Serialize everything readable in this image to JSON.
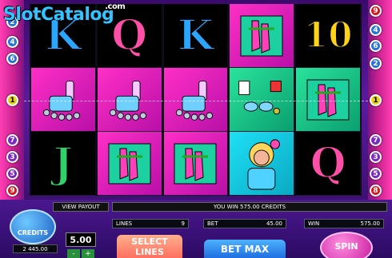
{
  "branding": {
    "name": "SlotCatalog",
    "suffix": ".com"
  },
  "paylines_left": [
    "2",
    "4",
    "6",
    "1",
    "7",
    "3",
    "5",
    "9"
  ],
  "paylines_right": [
    "9",
    "4",
    "6",
    "2",
    "1",
    "7",
    "3",
    "5",
    "8"
  ],
  "reels": [
    [
      {
        "type": "letter",
        "value": "K",
        "cls": "k"
      },
      {
        "type": "icon",
        "value": "spray-jewelry-icon",
        "bg": "pink"
      },
      {
        "type": "letter",
        "value": "J",
        "cls": "j"
      }
    ],
    [
      {
        "type": "letter",
        "value": "Q",
        "cls": "q"
      },
      {
        "type": "icon",
        "value": "spray-jewelry-icon",
        "bg": "pink"
      },
      {
        "type": "icon",
        "value": "leg-warmers-icon",
        "bg": "pink"
      }
    ],
    [
      {
        "type": "letter",
        "value": "K",
        "cls": "k"
      },
      {
        "type": "icon",
        "value": "spray-jewelry-icon",
        "bg": "pink"
      },
      {
        "type": "icon",
        "value": "leg-warmers-icon",
        "bg": "pink"
      }
    ],
    [
      {
        "type": "icon",
        "value": "leg-warmers-icon",
        "bg": "pink"
      },
      {
        "type": "icon",
        "value": "sunglasses-cube-icon",
        "bg": "green"
      },
      {
        "type": "icon",
        "value": "girl-character-icon",
        "bg": "cyan"
      }
    ],
    [
      {
        "type": "letter",
        "value": "10",
        "cls": "ten"
      },
      {
        "type": "icon",
        "value": "leg-warmers-icon",
        "bg": "green"
      },
      {
        "type": "letter",
        "value": "Q",
        "cls": "q"
      }
    ]
  ],
  "bottom": {
    "view_payout": "VIEW PAYOUT",
    "win_message": "YOU WIN 575.00 CREDITS",
    "lines_label": "LINES",
    "lines_value": "9",
    "bet_label": "BET",
    "bet_value": "45.00",
    "win_label": "WIN",
    "win_value": "575.00",
    "credits_label": "CREDITS",
    "credits_value": "2 445.00",
    "bet_per_line": "5.00",
    "bet_minus": "-",
    "bet_plus": "+",
    "select_lines": "SELECT LINES",
    "bet_max": "BET MAX",
    "spin": "SPIN"
  },
  "colors": {
    "accent": "#ff3fb4",
    "panel": "#4b1890",
    "reelBg": "#0d0d1a"
  }
}
